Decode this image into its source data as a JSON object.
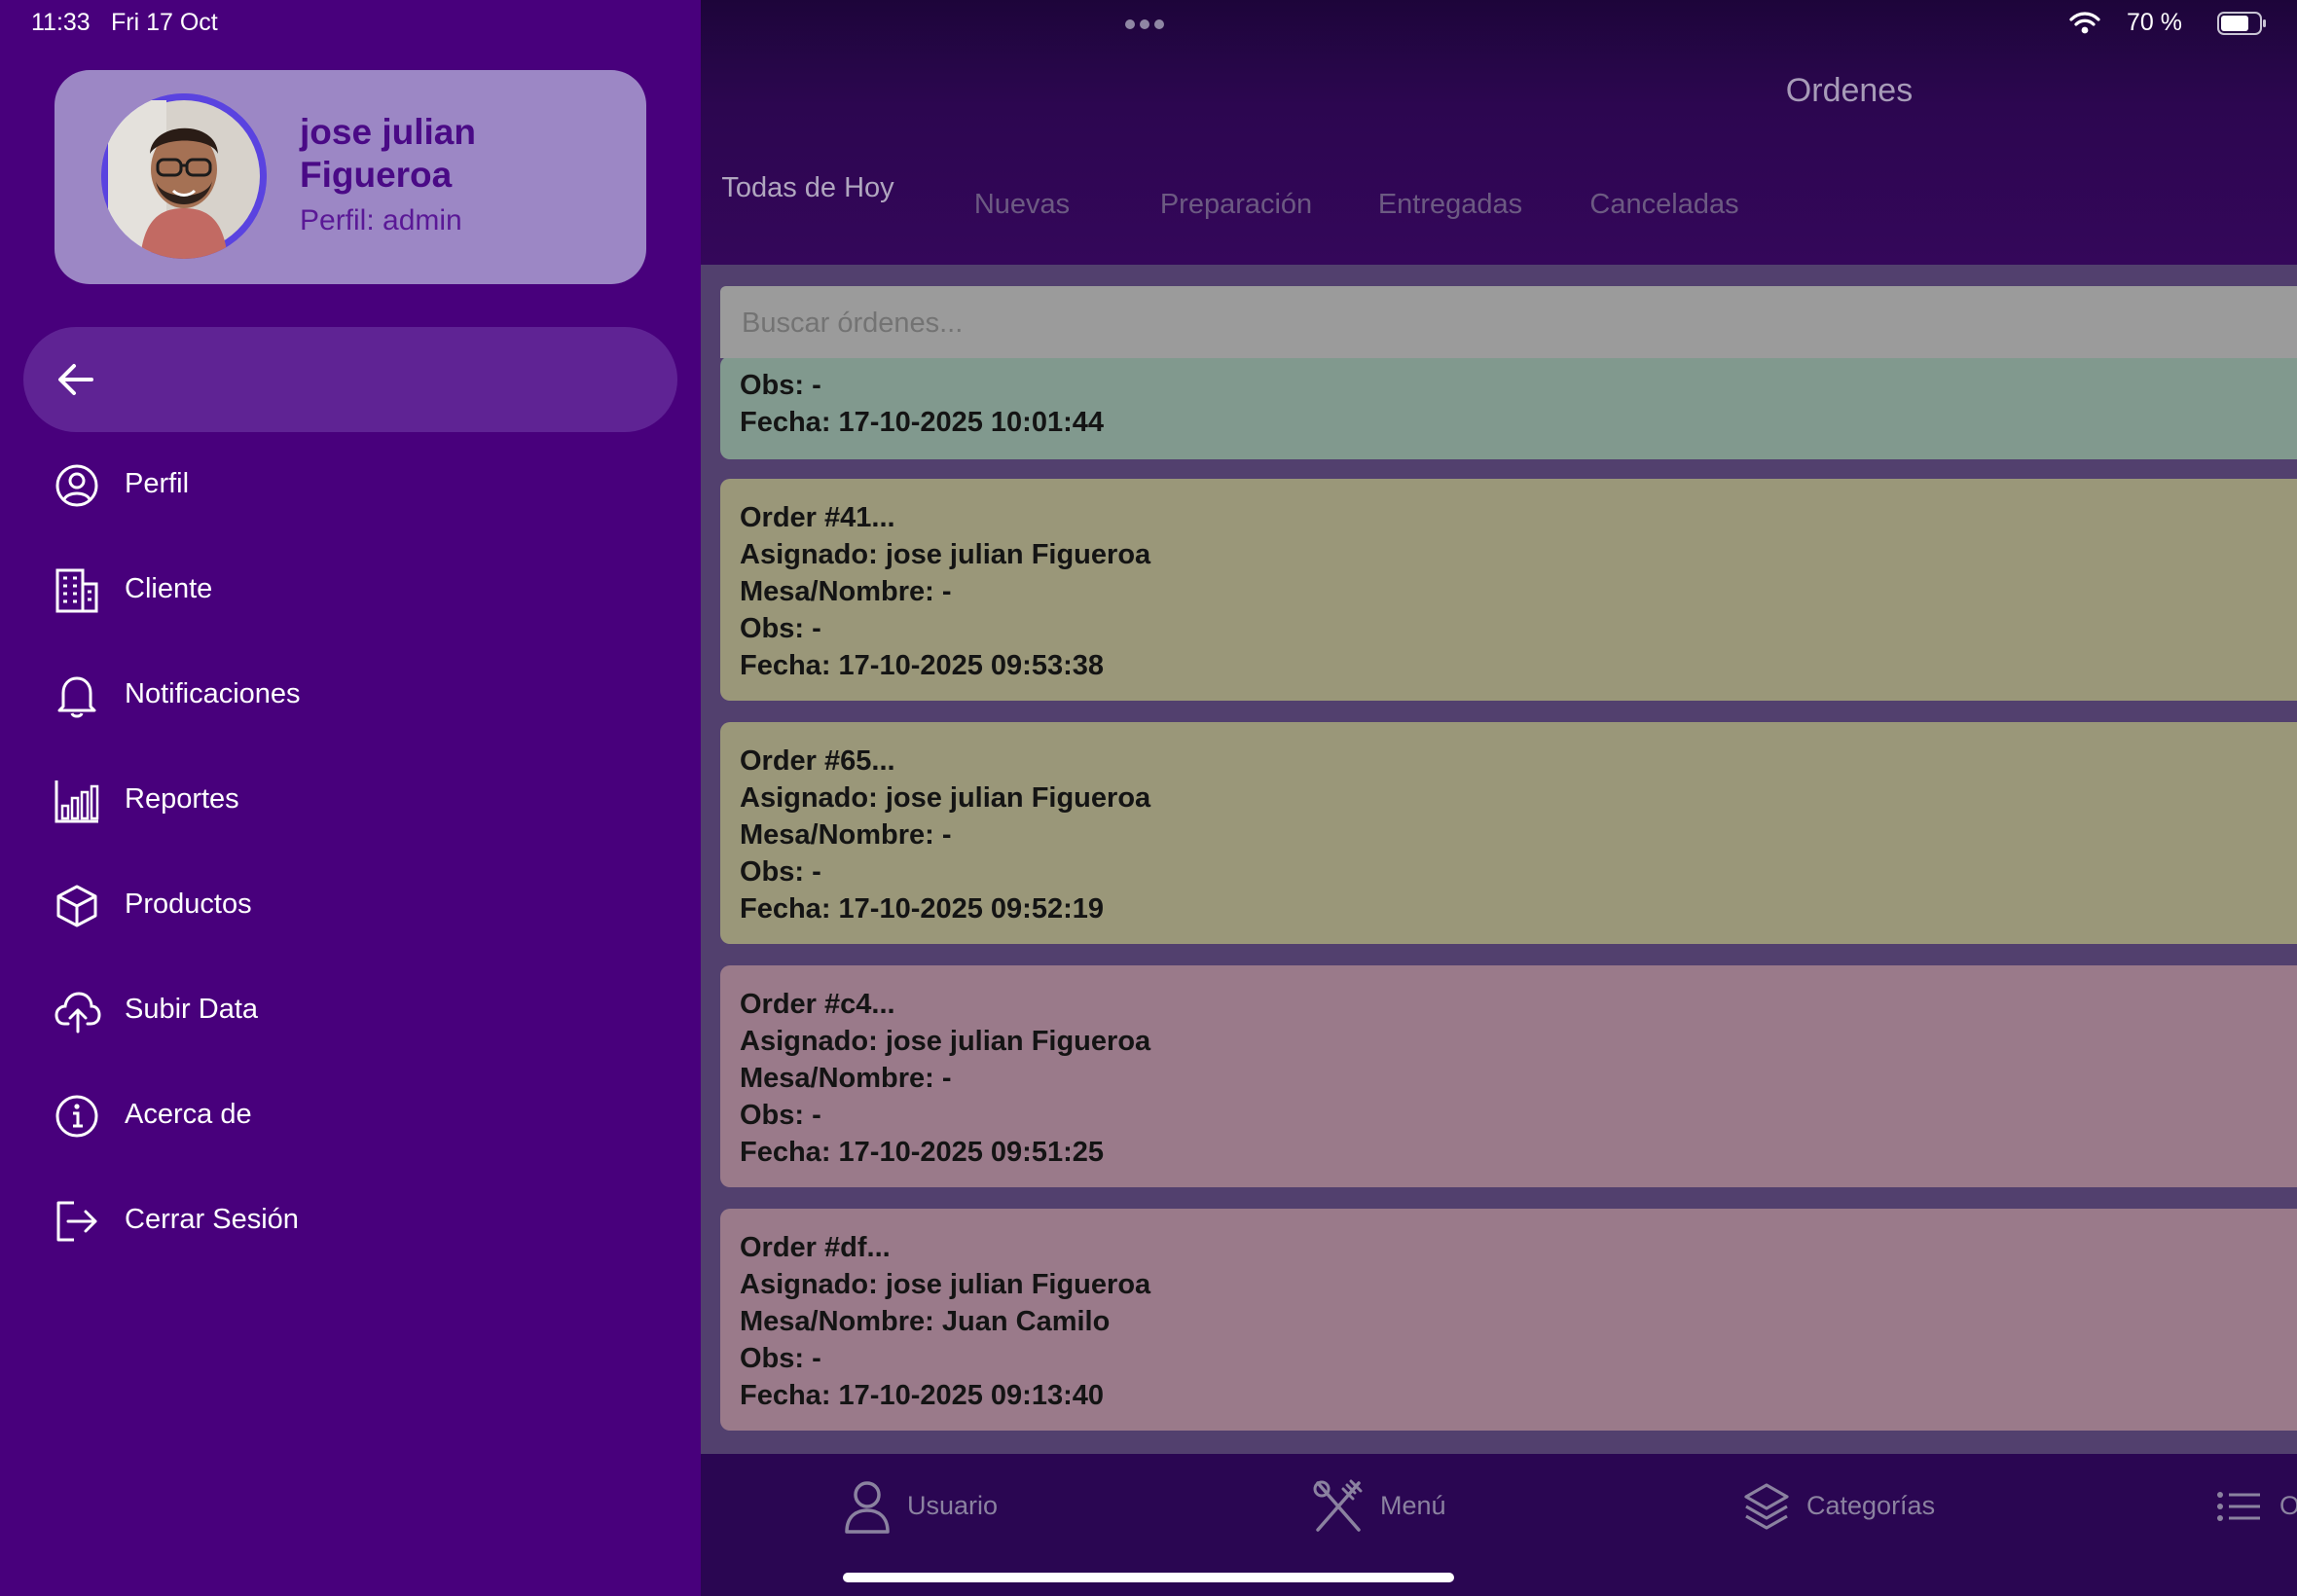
{
  "status_bar": {
    "time": "11:33",
    "date": "Fri 17 Oct",
    "battery": "70 %"
  },
  "drawer": {
    "profile": {
      "name": "jose julian Figueroa",
      "role": "Perfil: admin"
    },
    "menu": [
      {
        "label": "Perfil",
        "icon": "user-circle-icon"
      },
      {
        "label": "Cliente",
        "icon": "building-icon"
      },
      {
        "label": "Notificaciones",
        "icon": "bell-icon"
      },
      {
        "label": "Reportes",
        "icon": "bar-chart-icon"
      },
      {
        "label": "Productos",
        "icon": "box-icon"
      },
      {
        "label": "Subir Data",
        "icon": "cloud-upload-icon"
      },
      {
        "label": "Acerca de",
        "icon": "info-icon"
      },
      {
        "label": "Cerrar Sesión",
        "icon": "logout-icon"
      }
    ]
  },
  "header": {
    "title": "Ordenes",
    "tabs": [
      {
        "label": "Todas de Hoy",
        "active": true
      },
      {
        "label": "Nuevas"
      },
      {
        "label": "Preparación"
      },
      {
        "label": "Entregadas"
      },
      {
        "label": "Canceladas"
      }
    ]
  },
  "search": {
    "placeholder": "Buscar órdenes..."
  },
  "orders": [
    {
      "title": "",
      "asignado": "",
      "mesa": "",
      "obs": "Obs:  -",
      "fecha": "Fecha: 17-10-2025 10:01:44",
      "color": "#81998e"
    },
    {
      "title": "Order #41...",
      "asignado": "Asignado: jose julian Figueroa",
      "mesa": "Mesa/Nombre:  -",
      "obs": "Obs:  -",
      "fecha": "Fecha: 17-10-2025 09:53:38",
      "color": "#9a9779"
    },
    {
      "title": "Order #65...",
      "asignado": "Asignado: jose julian Figueroa",
      "mesa": "Mesa/Nombre:  -",
      "obs": "Obs:  -",
      "fecha": "Fecha: 17-10-2025 09:52:19",
      "color": "#9a9779"
    },
    {
      "title": "Order #c4...",
      "asignado": "Asignado: jose julian Figueroa",
      "mesa": "Mesa/Nombre:  -",
      "obs": "Obs:  -",
      "fecha": "Fecha: 17-10-2025 09:51:25",
      "color": "#9a7a8a"
    },
    {
      "title": "Order #df...",
      "asignado": "Asignado: jose julian Figueroa",
      "mesa": "Mesa/Nombre: Juan Camilo",
      "obs": "Obs:  -",
      "fecha": "Fecha: 17-10-2025 09:13:40",
      "color": "#9a7a8a"
    }
  ],
  "bottom_nav": [
    {
      "label": "Usuario",
      "icon": "user-icon"
    },
    {
      "label": "Menú",
      "icon": "utensils-icon"
    },
    {
      "label": "Categorías",
      "icon": "layers-icon"
    },
    {
      "label": "O",
      "icon": "list-icon"
    }
  ]
}
